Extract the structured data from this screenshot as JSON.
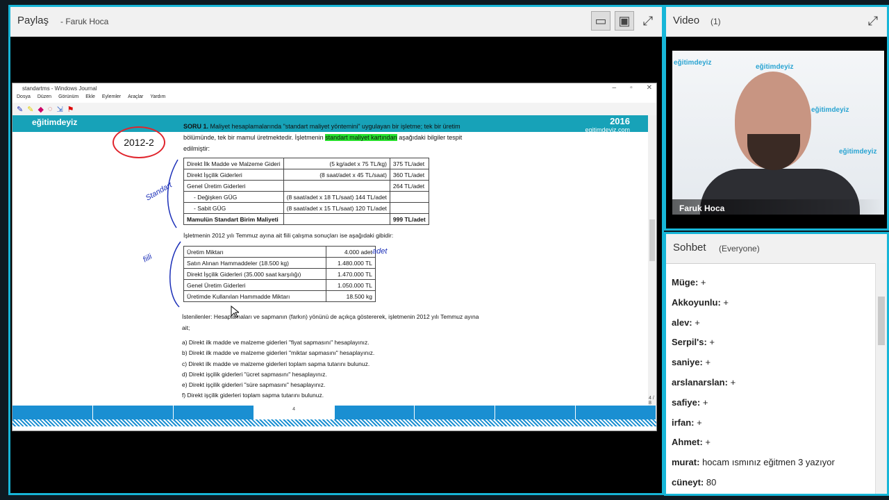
{
  "share": {
    "title": "Paylaş",
    "presenter": "- Faruk Hoca",
    "journal": {
      "window_title": "standartms - Windows Journal",
      "menu": [
        "Dosya",
        "Düzen",
        "Görünüm",
        "Ekle",
        "Eylemler",
        "Araçlar",
        "Yardım"
      ],
      "logo_left": "eğitimdeyiz",
      "logo_right_year": "2016",
      "logo_right_site": "egitimdeyiz.com",
      "page_label": "4",
      "page_counter": "4 / 8",
      "circle_note": "2012-2",
      "ink_standart": "Standart",
      "ink_fiili": "fiili",
      "ink_adet": "adet",
      "question_title": "SORU 1.",
      "question_text1": "Maliyet hesaplamalarında \"standart maliyet yöntemini\" uygulayan bir işletme; tek bir üretim bölümünde, tek bir mamul üretmektedir. İşletmenin",
      "question_highlight": "standart maliyet kartından",
      "question_text2": "aşağıdaki bilgiler tespit edilmiştir:",
      "table1": [
        [
          "Direkt İlk Madde ve Malzeme Gideri",
          "(5 kg/adet x 75 TL/kg)",
          "375 TL/adet"
        ],
        [
          "Direkt İşçilik Giderleri",
          "(8 saat/adet x 45 TL/saat)",
          "360 TL/adet"
        ],
        [
          "Genel Üretim Giderleri",
          "",
          "264 TL/adet"
        ],
        [
          "- Değişken GÜG",
          "(8 saat/adet x 18 TL/saat) 144 TL/adet",
          ""
        ],
        [
          "- Sabit GÜG",
          "(8 saat/adet x 15 TL/saat) 120 TL/adet",
          ""
        ],
        [
          "Mamulün Standart Birim Maliyeti",
          "",
          "999 TL/adet"
        ]
      ],
      "intro2": "İşletmenin 2012 yılı Temmuz ayına ait fiili çalışma sonuçları ise aşağıdaki gibidir:",
      "table2": [
        [
          "Üretim Miktarı",
          "4.000 adet"
        ],
        [
          "Satın Alınan Hammaddeler (18.500 kg)",
          "1.480.000 TL"
        ],
        [
          "Direkt İşçilik Giderleri (35.000 saat karşılığı)",
          "1.470.000 TL"
        ],
        [
          "Genel Üretim Giderleri",
          "1.050.000 TL"
        ],
        [
          "Üretimde Kullanılan Hammadde Miktarı",
          "18.500 kg"
        ]
      ],
      "istenilenler": "İstenilenler: Hesaplamaları ve sapmanın (farkın) yönünü de açıkça göstererek, işletmenin 2012 yılı Temmuz ayına ait;",
      "tasks": [
        "a) Direkt ilk madde ve malzeme giderleri \"fiyat sapmasını\" hesaplayınız.",
        "b) Direkt ilk madde ve malzeme giderleri \"miktar sapmasını\" hesaplayınız.",
        "c) Direkt ilk madde ve malzeme giderleri toplam sapma tutarını bulunuz.",
        "d) Direkt işçilik giderleri \"ücret sapmasını\" hesaplayınız.",
        "e) Direkt işçilik giderleri \"süre sapmasını\" hesaplayınız.",
        "f) Direkt işçilik giderleri toplam sapma tutarını bulunuz."
      ]
    }
  },
  "video": {
    "title": "Video",
    "count": "(1)",
    "name_tag": "Faruk Hoca",
    "watermark": "eğitimdeyiz"
  },
  "chat": {
    "title": "Sohbet",
    "scope": "(Everyone)",
    "messages": [
      {
        "user": "Müge:",
        "text": "+"
      },
      {
        "user": "Akkoyunlu:",
        "text": "+"
      },
      {
        "user": "alev:",
        "text": "+"
      },
      {
        "user": "Serpil's:",
        "text": "+"
      },
      {
        "user": "saniye:",
        "text": "+"
      },
      {
        "user": "arslanarslan:",
        "text": "+"
      },
      {
        "user": "safiye:",
        "text": "+"
      },
      {
        "user": "irfan:",
        "text": "+"
      },
      {
        "user": "Ahmet:",
        "text": "+"
      },
      {
        "user": "murat:",
        "text": "hocam ısmınız eğitmen 3 yazıyor"
      },
      {
        "user": "cüneyt:",
        "text": "80"
      }
    ]
  },
  "colors": {
    "pod_border": "#17b6d8",
    "brand_teal": "#17a2b8",
    "highlight": "#27e02d",
    "ink": "#1b2fb8"
  }
}
